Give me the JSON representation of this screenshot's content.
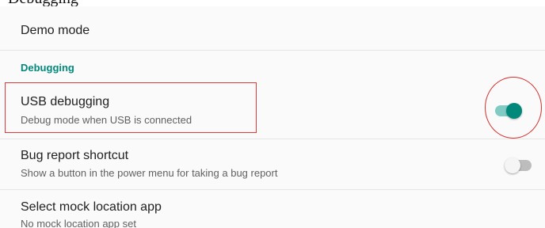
{
  "caption": "Debugging",
  "settings": {
    "demo_mode": {
      "title": "Demo mode"
    },
    "section_header": "Debugging",
    "usb_debugging": {
      "title": "USB debugging",
      "summary": "Debug mode when USB is connected",
      "toggle_state": "on"
    },
    "bug_report_shortcut": {
      "title": "Bug report shortcut",
      "summary": "Show a button in the power menu for taking a bug report",
      "toggle_state": "off"
    },
    "mock_location": {
      "title": "Select mock location app",
      "summary": "No mock location app set"
    }
  },
  "colors": {
    "accent": "#00897b",
    "annotation": "#e53935"
  }
}
